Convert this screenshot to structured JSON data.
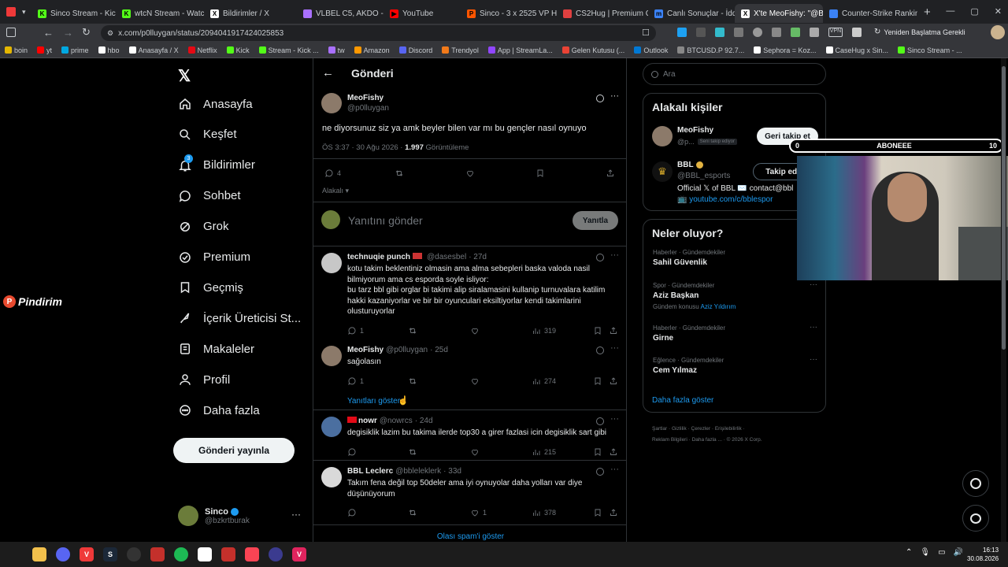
{
  "browser": {
    "tabs": [
      {
        "label": "Sinco Stream - Kick Das",
        "color": "#53fc18",
        "glyph": "K"
      },
      {
        "label": "wtcN Stream - Watch Li",
        "color": "#53fc18",
        "glyph": "K"
      },
      {
        "label": "Bildirimler / X",
        "color": "#ffffff",
        "glyph": "X"
      },
      {
        "label": "VLBEL C5, AKDO - uzayl",
        "color": "#a970ff",
        "glyph": ""
      },
      {
        "label": "YouTube",
        "color": "#ff0000",
        "glyph": "▶"
      },
      {
        "label": "Sinco - 3 x 2525 VP Hed",
        "color": "#ff5500",
        "glyph": "P"
      },
      {
        "label": "CS2Hug | Premium CS2",
        "color": "#e04040",
        "glyph": ""
      },
      {
        "label": "Canlı Sonuçlar - İddaa S",
        "color": "#3b82f6",
        "glyph": "m"
      },
      {
        "label": "X'te MeoFishy: \"@BBL_e",
        "color": "#ffffff",
        "glyph": "X",
        "active": true
      },
      {
        "label": "Counter-Strike Ranking |",
        "color": "#3b82f6",
        "glyph": ""
      }
    ],
    "url": "x.com/p0lluygan/status/2094041917424025853",
    "restart_label": "Yeniden Başlatma Gerekli",
    "bookmarks": [
      {
        "label": "boin",
        "color": "#e5b700"
      },
      {
        "label": "yt",
        "color": "#ff0000"
      },
      {
        "label": "prime",
        "color": "#00a8e1"
      },
      {
        "label": "hbo",
        "color": "#ffffff"
      },
      {
        "label": "Anasayfa / X",
        "color": "#ffffff"
      },
      {
        "label": "Netflix",
        "color": "#e50914"
      },
      {
        "label": "Kick",
        "color": "#53fc18"
      },
      {
        "label": "Stream - Kick ...",
        "color": "#53fc18"
      },
      {
        "label": "tw",
        "color": "#a970ff"
      },
      {
        "label": "Amazon",
        "color": "#ff9900"
      },
      {
        "label": "Discord",
        "color": "#5865f2"
      },
      {
        "label": "Trendyol",
        "color": "#f27a1a"
      },
      {
        "label": "App | StreamLa...",
        "color": "#9146ff"
      },
      {
        "label": "Gelen Kutusu (...",
        "color": "#ea4335"
      },
      {
        "label": "Outlook",
        "color": "#0078d4"
      },
      {
        "label": "BTCUSD.P 92.7...",
        "color": "#888888"
      },
      {
        "label": "Sephora = Koz...",
        "color": "#ffffff"
      },
      {
        "label": "CaseHug x Sin...",
        "color": "#ffffff"
      },
      {
        "label": "Sinco Stream - ...",
        "color": "#53fc18"
      }
    ]
  },
  "nav": {
    "items": [
      "Anasayfa",
      "Keşfet",
      "Bildirimler",
      "Sohbet",
      "Grok",
      "Premium",
      "Geçmiş",
      "İçerik Üreticisi St...",
      "Makaleler",
      "Profil",
      "Daha fazla"
    ],
    "notif_badge": "3",
    "post_button": "Gönderi yayınla",
    "account": {
      "name": "Sinco",
      "handle": "@bzkrtburak"
    }
  },
  "overlay_logo": "Pindirim",
  "main": {
    "header": "Gönderi",
    "post": {
      "name": "MeoFishy",
      "handle": "@p0lluygan",
      "text": "ne diyorsunuz siz ya amk beyler bilen var mı bu gençler nasıl oynuyo",
      "meta_time": "ÖS 3:37 · 30 Ağu 2026 · ",
      "views": "1.997",
      "views_label": " Görüntüleme",
      "replies": "4",
      "related": "Alakalı"
    },
    "reply_box": {
      "placeholder": "Yanıtını gönder",
      "button": "Yanıtla"
    },
    "replies": [
      {
        "name": "technuqie punch",
        "handle": "@dasesbel",
        "time": "· 27d",
        "lines": [
          "kotu takim beklentiniz olmasin ama alma sebepleri baska valoda nasil",
          "bilmiyorum ama cs esporda soyle isliyor:",
          "bu tarz bbl gibi orglar bi takimi alip siralamasini kullanip turnuvalara katilim",
          "hakki kazaniyorlar ve bir bir oyunculari eksiltiyorlar kendi takimlarini",
          "olusturuyorlar"
        ],
        "replies": "1",
        "likes": "",
        "views": "319"
      },
      {
        "name": "MeoFishy",
        "handle": "@p0lluygan",
        "time": "· 25d",
        "lines": [
          "sağolasın"
        ],
        "replies": "1",
        "likes": "",
        "views": "274",
        "show_replies": "Yanıtları göster"
      },
      {
        "name": "nowr",
        "handle": "@nowrcs",
        "time": "· 24d",
        "lines": [
          "degisiklik lazim bu takima ilerde top30 a girer fazlasi icin degisiklik sart gibi"
        ],
        "replies": "",
        "likes": "",
        "views": "215"
      },
      {
        "name": "BBL Leclerc",
        "handle": "@bbleleklerk",
        "time": "· 33d",
        "lines": [
          "Takım fena değil top 50deler ama iyi oynuyolar daha yolları var diye",
          "düşünüyorum"
        ],
        "replies": "",
        "likes": "1",
        "views": "378"
      }
    ],
    "spam_link": "Olası spam'i göster"
  },
  "sidebar": {
    "search_placeholder": "Ara",
    "related_title": "Alakalı kişiler",
    "people": [
      {
        "name": "MeoFishy",
        "handle": "@p...",
        "tag": "Seni takip ediyor",
        "button": "Geri takip et"
      },
      {
        "name": "BBL",
        "handle": "@BBL_esports",
        "button": "Takip edil",
        "bio": "Official 𝕏 of BBL ✉️ contact@bbl",
        "link": "📺 youtube.com/c/bblespor"
      }
    ],
    "trends_title": "Neler oluyor?",
    "trends": [
      {
        "category": "Haberler · Gündemdekiler",
        "title": "Sahil Güvenlik",
        "sub": ""
      },
      {
        "category": "Spor · Gündemdekiler",
        "title": "Aziz Başkan",
        "sub": "Gündem konusu ",
        "sub_link": "Aziz Yıldırım"
      },
      {
        "category": "Haberler · Gündemdekiler",
        "title": "Girne",
        "sub": ""
      },
      {
        "category": "Eğlence · Gündemdekiler",
        "title": "Cem Yılmaz",
        "sub": ""
      }
    ],
    "show_more": "Daha fazla göster",
    "footer": [
      "Şartlar",
      "Gizlilik",
      "Çerezler",
      "Erişilebilirlik",
      "Reklam Bilgileri",
      "Daha fazla ...",
      "© 2026 X Corp."
    ]
  },
  "stream_overlay": {
    "left": "0",
    "label": "ABONEEE",
    "right": "10"
  },
  "taskbar": {
    "time": "16:13",
    "date": "30.08.2026"
  },
  "colors": {
    "accent": "#1d9bf0",
    "bg": "#000000",
    "border": "#2f3336"
  }
}
